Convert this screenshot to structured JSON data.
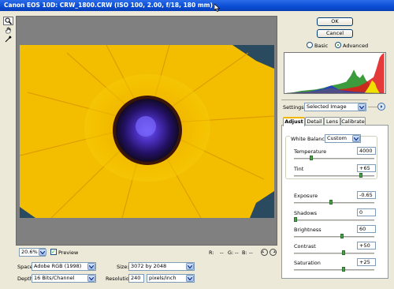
{
  "window": {
    "title": "Canon EOS 10D:  CRW_1800.CRW  (ISO 100, 2.00, f/18, 180 mm)"
  },
  "preview_controls": {
    "zoom": "20.6%",
    "preview_label": "Preview",
    "rgb_readout": {
      "r": "R:",
      "r_val": "--",
      "g": "G:",
      "g_val": "--",
      "b": "B:",
      "b_val": "--"
    }
  },
  "workflow": {
    "space_label": "Space:",
    "space_value": "Adobe RGB (1998)",
    "depth_label": "Depth:",
    "depth_value": "16 Bits/Channel",
    "size_label": "Size:",
    "size_value": "3072 by 2048",
    "resolution_label": "Resolution:",
    "resolution_value": "240",
    "resolution_unit": "pixels/inch"
  },
  "buttons": {
    "ok": "OK",
    "cancel": "Cancel"
  },
  "mode": {
    "basic": "Basic",
    "advanced": "Advanced",
    "selected": "advanced"
  },
  "settings": {
    "label": "Settings:",
    "value": "Selected Image"
  },
  "tabs": [
    {
      "label": "Adjust",
      "active": true
    },
    {
      "label": "Detail"
    },
    {
      "label": "Lens"
    },
    {
      "label": "Calibrate"
    }
  ],
  "white_balance": {
    "label": "White Balance:",
    "value": "Custom",
    "temperature_label": "Temperature",
    "temperature": "4000",
    "temperature_level": 0.22,
    "tint_label": "Tint",
    "tint": "+65",
    "tint_level": 0.83
  },
  "adjust": [
    {
      "label": "Exposure",
      "value": "-0.65",
      "level": 0.46
    },
    {
      "label": "Shadows",
      "value": "0",
      "level": 0.02
    },
    {
      "label": "Brightness",
      "value": "60",
      "level": 0.6
    },
    {
      "label": "Contrast",
      "value": "+50",
      "level": 0.62
    },
    {
      "label": "Saturation",
      "value": "+25",
      "level": 0.62
    }
  ],
  "colors": {
    "titlebar": "#0a4cd4",
    "slider_thumb": "#4aa24a",
    "preview_bg": "#808080"
  }
}
